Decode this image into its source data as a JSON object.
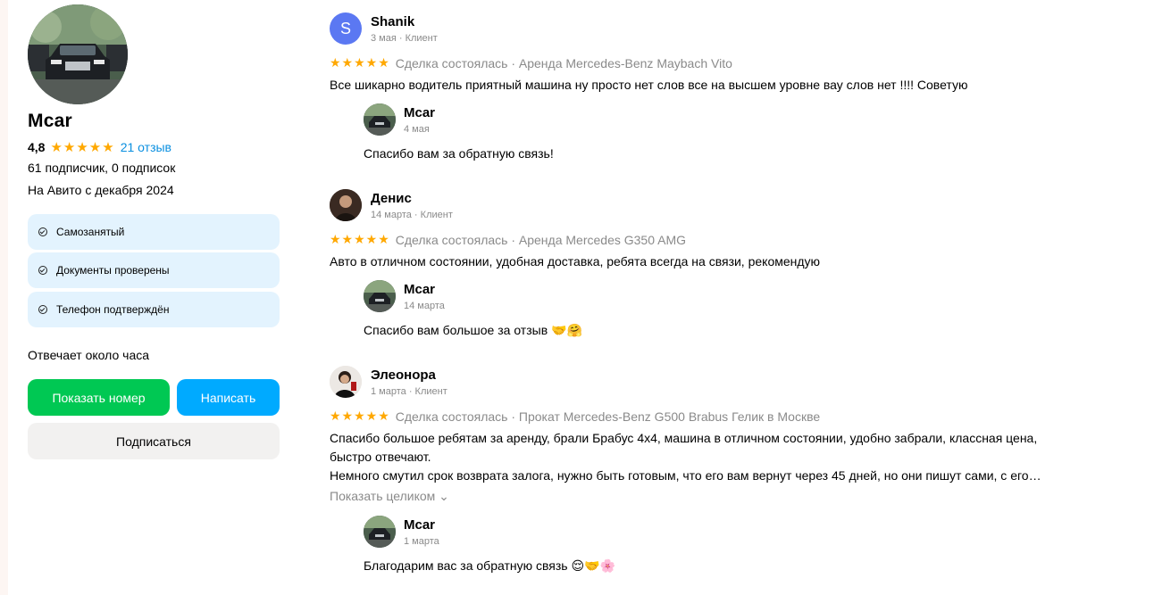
{
  "profile": {
    "name": "Mcar",
    "rating": "4,8",
    "stars": "★★★★★",
    "reviews_link": "21 отзыв",
    "subscribers": "61 подписчик, 0 подписок",
    "since": "На Авито с декабря 2024",
    "badges": [
      {
        "label": "Самозанятый",
        "icon": "check-circle-icon"
      },
      {
        "label": "Документы проверены",
        "icon": "check-circle-icon"
      },
      {
        "label": "Телефон подтверждён",
        "icon": "check-circle-icon"
      }
    ],
    "response_time": "Отвечает около часа",
    "buttons": {
      "show_phone": "Показать номер",
      "write": "Написать",
      "subscribe": "Подписаться"
    }
  },
  "reviews": [
    {
      "author": "Shanik",
      "avatar_letter": "S",
      "meta": "3 мая · Клиент",
      "stars": "★★★★★",
      "deal": "Сделка состоялась · Аренда Mercedes-Benz Maybach Vito",
      "text": "Все шикарно водитель приятный машина ну просто нет слов все на высшем уровне вау слов нет !!!! Советую",
      "reply": {
        "author": "Mcar",
        "date": "4 мая",
        "text": "Спасибо вам за обратную связь!"
      }
    },
    {
      "author": "Денис",
      "meta": "14 марта · Клиент",
      "stars": "★★★★★",
      "deal": "Сделка состоялась · Аренда Mercedes G350 AMG",
      "text": "Авто в отличном состоянии, удобная доставка, ребята всегда на связи, рекомендую",
      "reply": {
        "author": "Mcar",
        "date": "14 марта",
        "text": "Спасибо вам большое за отзыв 🤝🤗"
      }
    },
    {
      "author": "Элеонора",
      "meta": "1 марта · Клиент",
      "stars": "★★★★★",
      "deal": "Сделка состоялась · Прокат Mercedes-Benz G500 Brabus Гелик в Москве",
      "text_line1": "Спасибо большое ребятам за аренду, брали Брабус 4х4, машина в отличном состоянии, удобно забрали, классная цена,",
      "text_line2": "быстро отвечают.",
      "text_line3": "Немного смутил срок возврата залога, нужно быть готовым, что его вам вернут через 45 дней, но они пишут сами, с его…",
      "show_full": "Показать целиком ⌄",
      "reply": {
        "author": "Mcar",
        "date": "1 марта",
        "text": "Благодарим вас за обратную связь 😌🤝🌸"
      }
    }
  ],
  "colors": {
    "accent_green": "#00c853",
    "accent_blue": "#00aaff",
    "star": "#ffa800",
    "link": "#0a8fe0",
    "badge_bg": "#e3f3fe"
  }
}
